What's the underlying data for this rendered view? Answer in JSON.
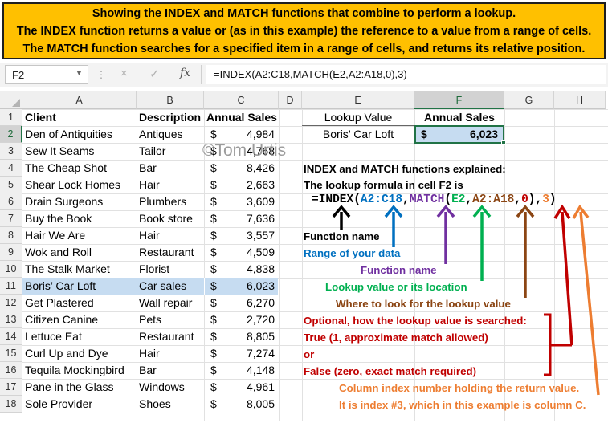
{
  "banner": {
    "line1": "Showing the INDEX and MATCH functions that combine to perform a lookup.",
    "line2": "The INDEX function returns a value or (as in this example) the reference to a value from a range of cells.",
    "line3": "The MATCH function searches for a specified item in a range of cells, and returns its relative position."
  },
  "formula_bar": {
    "name_box": "F2",
    "formula": "=INDEX(A2:C18,MATCH(E2,A2:A18,0),3)",
    "fx_label": "fx",
    "cancel_icon": "×",
    "enter_icon": "✓"
  },
  "columns": [
    "A",
    "B",
    "C",
    "D",
    "E",
    "F",
    "G",
    "H"
  ],
  "rows": [
    "1",
    "2",
    "3",
    "4",
    "5",
    "6",
    "7",
    "8",
    "9",
    "10",
    "11",
    "12",
    "13",
    "14",
    "15",
    "16",
    "17",
    "18"
  ],
  "headers": {
    "client": "Client",
    "description": "Description",
    "annual_sales": "Annual Sales"
  },
  "currency": "$",
  "table": [
    {
      "client": "Den of Antiquities",
      "description": "Antiques",
      "sales": "4,984"
    },
    {
      "client": "Sew It Seams",
      "description": "Tailor",
      "sales": "4,768"
    },
    {
      "client": "The Cheap Shot",
      "description": "Bar",
      "sales": "8,426"
    },
    {
      "client": "Shear Lock Homes",
      "description": "Hair",
      "sales": "2,663"
    },
    {
      "client": "Drain Surgeons",
      "description": "Plumbers",
      "sales": "3,609"
    },
    {
      "client": "Buy the Book",
      "description": "Book store",
      "sales": "7,636"
    },
    {
      "client": "Hair We Are",
      "description": "Hair",
      "sales": "3,557"
    },
    {
      "client": "Wok and Roll",
      "description": "Restaurant",
      "sales": "4,509"
    },
    {
      "client": "The Stalk Market",
      "description": "Florist",
      "sales": "4,838"
    },
    {
      "client": "Boris’ Car Loft",
      "description": "Car sales",
      "sales": "6,023"
    },
    {
      "client": "Get Plastered",
      "description": "Wall repair",
      "sales": "6,270"
    },
    {
      "client": "Citizen Canine",
      "description": "Pets",
      "sales": "2,720"
    },
    {
      "client": "Lettuce Eat",
      "description": "Restaurant",
      "sales": "8,805"
    },
    {
      "client": "Curl Up and Dye",
      "description": "Hair",
      "sales": "7,274"
    },
    {
      "client": "Tequila Mockingbird",
      "description": "Bar",
      "sales": "4,148"
    },
    {
      "client": "Pane in the Glass",
      "description": "Windows",
      "sales": "4,961"
    },
    {
      "client": "Sole Provider",
      "description": "Shoes",
      "sales": "8,005"
    }
  ],
  "lookup": {
    "value_header": "Lookup Value",
    "sales_header": "Annual Sales",
    "value": "Boris’ Car Loft",
    "result": "6,023"
  },
  "watermark": "©Tom Urtis",
  "explanation": {
    "title": "INDEX and MATCH functions explained:",
    "subtitle": "The lookup formula in cell F2 is",
    "formula_parts": {
      "p1": "=INDEX(",
      "p2": "A2:C18",
      "p3": ",",
      "p4": "MATCH",
      "p5": "(",
      "p6": "E2",
      "p7": ",",
      "p8": "A2:A18",
      "p9": ",",
      "p10": "0",
      "p11": "),",
      "p12": "3",
      "p13": ")"
    },
    "function_name": "Function name",
    "range_of_data": "Range of your data",
    "function_name2": "Function name",
    "lookup_value": "Lookup value or its location",
    "where_to_look": "Where to look for the lookup value",
    "optional": "Optional, how the lookup value is searched:",
    "true_text": "True (1, approximate match allowed)",
    "or_text": "or",
    "false_text": "False (zero, exact match required)",
    "column_index": "Column index number holding the return value.",
    "index_note": "It is index #3, which in this example is column C."
  },
  "colors": {
    "banner": "#ffc000",
    "selection": "#217346",
    "highlight": "#c6dcf1",
    "black": "#000000",
    "blue": "#0070c0",
    "purple": "#7030a0",
    "green": "#00b050",
    "brown": "#8b4513",
    "red": "#c00000",
    "orange": "#ed7d31"
  }
}
